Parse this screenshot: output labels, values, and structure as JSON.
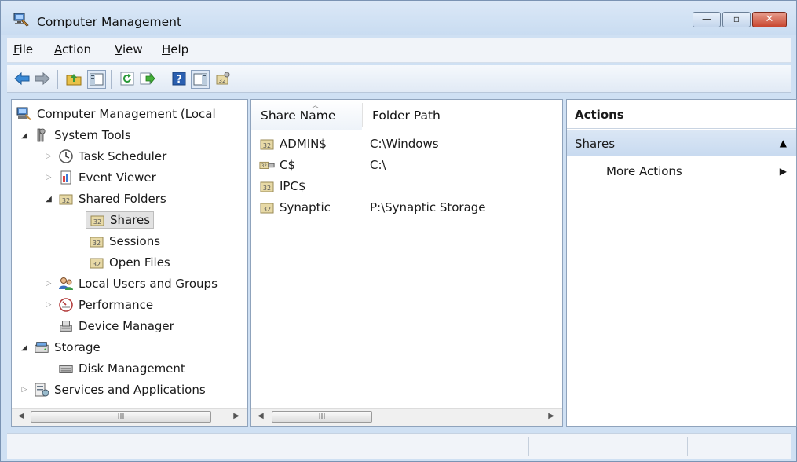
{
  "window": {
    "title": "Computer Management",
    "controls": {
      "minimize": "—",
      "maximize": "▫",
      "close": "✕"
    }
  },
  "menu": [
    {
      "key": "F",
      "rest": "ile"
    },
    {
      "key": "A",
      "rest": "ction"
    },
    {
      "key": "V",
      "rest": "iew"
    },
    {
      "key": "H",
      "rest": "elp"
    }
  ],
  "toolbar_icons": [
    "back-arrow-icon",
    "forward-arrow-icon",
    "up-folder-icon",
    "show-hide-tree-icon",
    "refresh-icon",
    "export-list-icon",
    "help-icon",
    "show-hide-action-pane-icon",
    "shared-folder-properties-icon"
  ],
  "tree": {
    "root": "Computer Management (Local",
    "system_tools": "System Tools",
    "task_scheduler": "Task Scheduler",
    "event_viewer": "Event Viewer",
    "shared_folders": "Shared Folders",
    "shares": "Shares",
    "sessions": "Sessions",
    "open_files": "Open Files",
    "local_users": "Local Users and Groups",
    "performance": "Performance",
    "device_manager": "Device Manager",
    "storage": "Storage",
    "disk_management": "Disk Management",
    "services": "Services and Applications"
  },
  "list": {
    "columns": [
      "Share Name",
      "Folder Path"
    ],
    "rows": [
      {
        "name": "ADMIN$",
        "path": "C:\\Windows"
      },
      {
        "name": "C$",
        "path": "C:\\"
      },
      {
        "name": "IPC$",
        "path": ""
      },
      {
        "name": "Synaptic",
        "path": "P:\\Synaptic Storage"
      }
    ]
  },
  "actions": {
    "title": "Actions",
    "section": "Shares",
    "item": "More Actions"
  },
  "scrollbar": {
    "thumb_grip": "III"
  },
  "colors": {
    "selection_bg": "#e2e2e2",
    "actions_section_bg": "#c8daf0",
    "close_btn": "#c8452e"
  }
}
